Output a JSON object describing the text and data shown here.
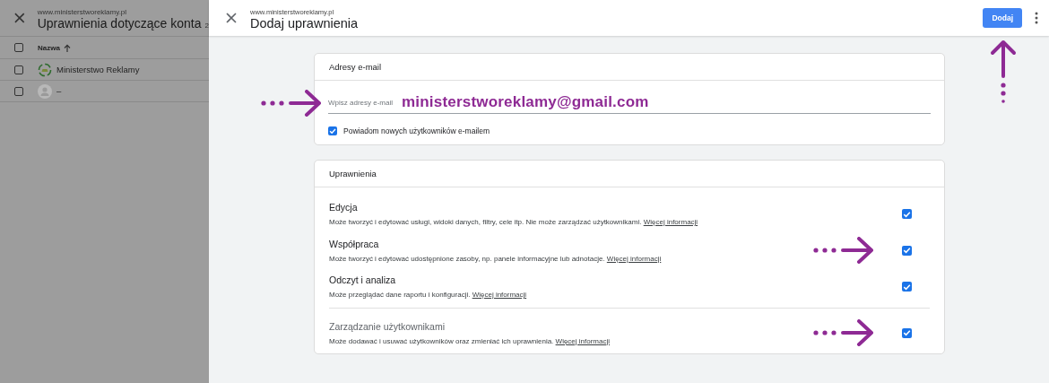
{
  "background_page": {
    "site": "www.ministerstworeklamy.pl",
    "title": "Uprawnienia dotyczące konta",
    "count": "2",
    "select_all_checked": false,
    "columns": [
      {
        "label": "Nazwa",
        "sorted_ascending": true
      }
    ],
    "rows": [
      {
        "kind": "account",
        "name": "Ministerstwo Reklamy",
        "checked": false
      },
      {
        "kind": "user",
        "name": "–",
        "checked": false
      }
    ]
  },
  "dialog": {
    "site": "www.ministerstworeklamy.pl",
    "title": "Dodaj uprawnienia",
    "add_button": {
      "label": "Dodaj",
      "arrow": true
    },
    "email_card": {
      "title": "Adresy e-mail",
      "field": {
        "placeholder": "Wpisz adresy e-mail",
        "value": "ministerstworeklamy@gmail.com",
        "arrow": true
      },
      "notify": {
        "label": "Powiadom nowych użytkowników e-mailem",
        "checked": true
      }
    },
    "permissions_card": {
      "title": "Uprawnienia",
      "items": [
        {
          "kind": "role",
          "title": "Edycja",
          "description": "Może tworzyć i edytować usługi, widoki danych, filtry, cele itp. Nie może zarządzać użytkownikami.",
          "link": "Więcej informacji",
          "checked": true,
          "arrow": false
        },
        {
          "kind": "role",
          "title": "Współpraca",
          "description": "Może tworzyć i edytować udostępnione zasoby, np. panele informacyjne lub adnotacje.",
          "link": "Więcej informacji",
          "checked": true,
          "arrow": true
        },
        {
          "kind": "role",
          "title": "Odczyt i analiza",
          "description": "Może przeglądać dane raportu i konfiguracji.",
          "link": "Więcej informacji",
          "checked": true,
          "arrow": false
        },
        {
          "kind": "admin",
          "title": "Zarządzanie użytkownikami",
          "description": "Może dodawać i usuwać użytkowników oraz zmieniać ich uprawnienia.",
          "link": "Więcej informacji",
          "checked": true,
          "arrow": true
        }
      ]
    }
  }
}
